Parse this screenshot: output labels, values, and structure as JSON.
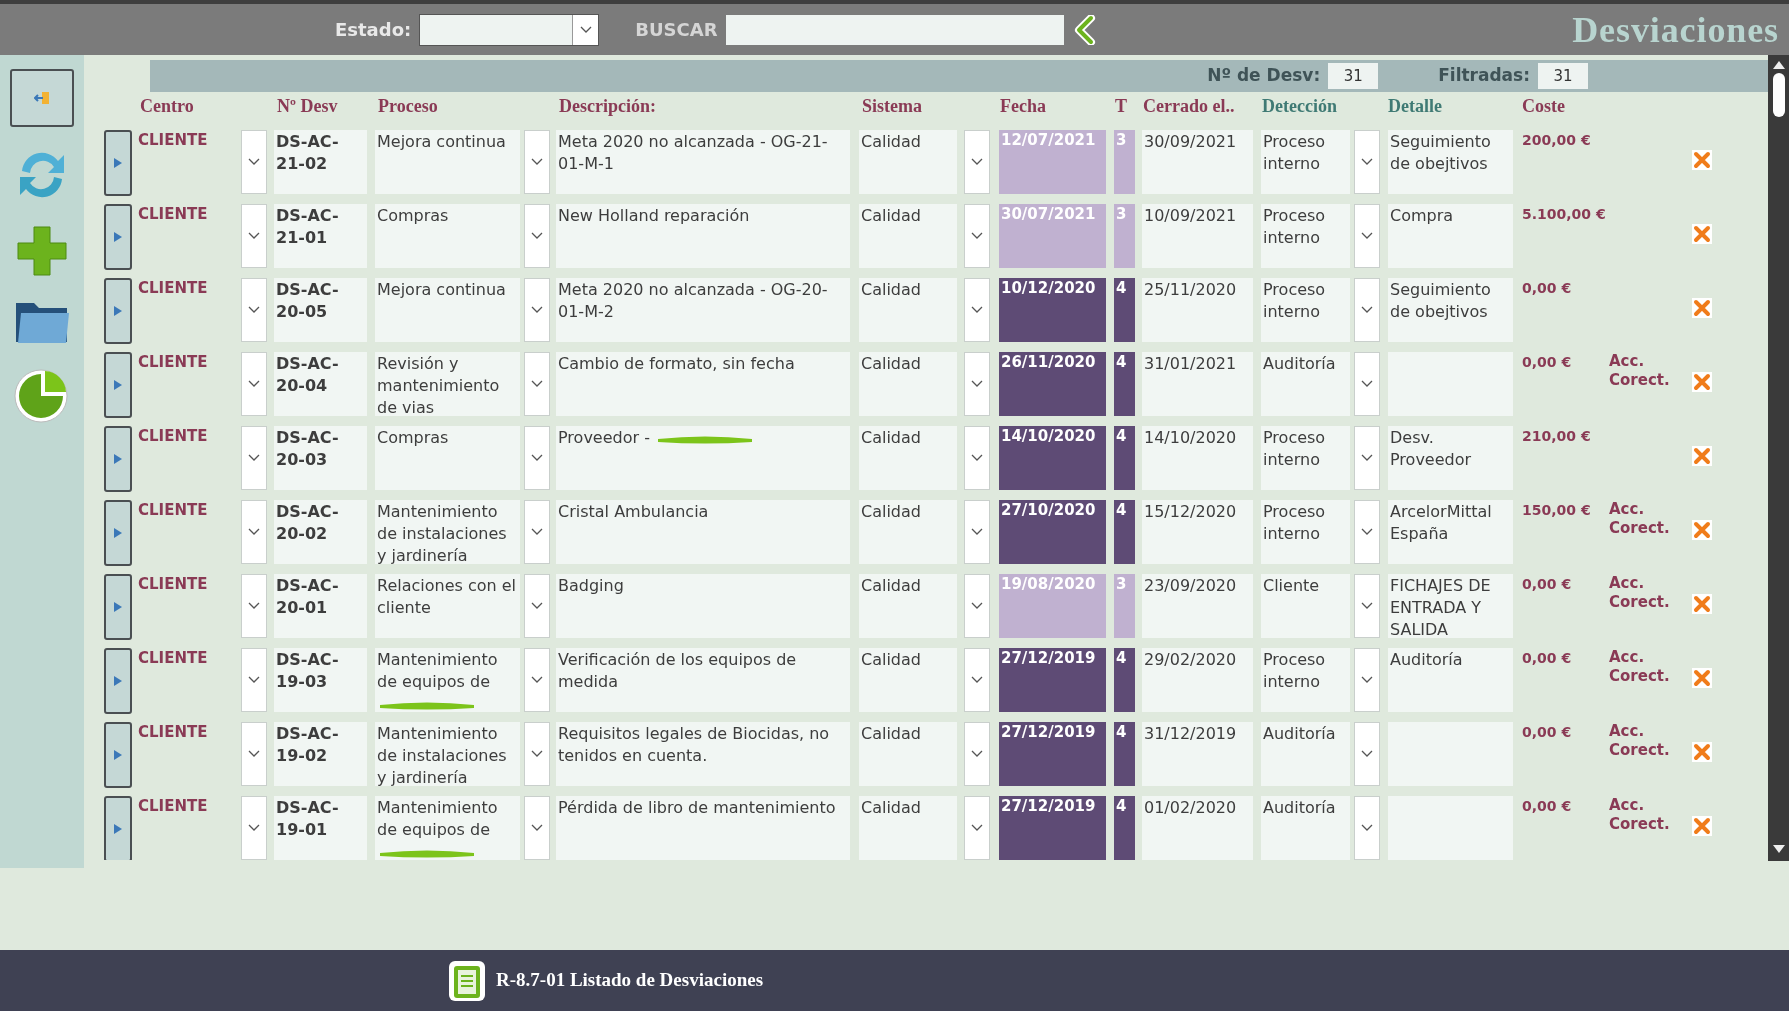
{
  "topbar": {
    "estado_label": "Estado:",
    "buscar_label": "BUSCAR",
    "title": "Desviaciones"
  },
  "counts": {
    "total_label": "Nº de Desv:",
    "total": "31",
    "filtered_label": "Filtradas:",
    "filtered": "31"
  },
  "columns": [
    "Centro",
    "Nº Desv",
    "Proceso",
    "Descripción:",
    "Sistema",
    "Fecha",
    "T",
    "Cerrado el..",
    "Detección",
    "Detalle",
    "Coste"
  ],
  "rows": [
    {
      "centro": "CLIENTE",
      "num": "DS-AC-21-02",
      "proceso": "Mejora continua",
      "descripcion": "Meta 2020 no alcanzada - OG-21-01-M-1",
      "sistema": "Calidad",
      "fecha": "12/07/2021",
      "color": "#c0b1d0",
      "t": "3",
      "cerrado": "30/09/2021",
      "deteccion": "Proceso interno",
      "detalle": "Seguimiento de obejtivos",
      "coste": "200,00 €",
      "checked": true
    },
    {
      "centro": "CLIENTE",
      "num": "DS-AC-21-01",
      "proceso": "Compras",
      "descripcion": "New Holland reparación",
      "sistema": "Calidad",
      "fecha": "30/07/2021",
      "color": "#c0b1d0",
      "t": "3",
      "cerrado": "10/09/2021",
      "deteccion": "Proceso interno",
      "detalle": "Compra",
      "coste": "5.100,00 €",
      "checked": true
    },
    {
      "centro": "CLIENTE",
      "num": "DS-AC-20-05",
      "proceso": "Mejora continua",
      "descripcion": "Meta 2020 no alcanzada - OG-20-01-M-2",
      "sistema": "Calidad",
      "fecha": "10/12/2020",
      "color": "#5e4b75",
      "t": "4",
      "cerrado": "25/11/2020",
      "deteccion": "Proceso interno",
      "detalle": "Seguimiento de obejtivos",
      "coste": "0,00 €",
      "checked": true
    },
    {
      "centro": "CLIENTE",
      "num": "DS-AC-20-04",
      "proceso": "Revisión y mantenimiento de vias",
      "descripcion": "Cambio de formato, sin fecha",
      "sistema": "Calidad",
      "fecha": "26/11/2020",
      "color": "#5e4b75",
      "t": "4",
      "cerrado": "31/01/2021",
      "deteccion": "Auditoría",
      "coste": "0,00 €",
      "accion": "Acc. Corect.",
      "checked": true
    },
    {
      "centro": "CLIENTE",
      "num": "DS-AC-20-03",
      "proceso": "Compras",
      "descripcion": "Proveedor - ",
      "descripcion_redacted": true,
      "sistema": "Calidad",
      "fecha": "14/10/2020",
      "color": "#5e4b75",
      "t": "4",
      "cerrado": "14/10/2020",
      "deteccion": "Proceso interno",
      "detalle": "Desv. Proveedor",
      "coste": "210,00 €",
      "checked": true
    },
    {
      "centro": "CLIENTE",
      "num": "DS-AC-20-02",
      "proceso": "Mantenimiento de instalaciones y jardinería",
      "descripcion": "Cristal Ambulancia",
      "sistema": "Calidad",
      "fecha": "27/10/2020",
      "color": "#5e4b75",
      "t": "4",
      "cerrado": "15/12/2020",
      "deteccion": "Proceso interno",
      "detalle": "ArcelorMittal España",
      "coste": "150,00 €",
      "accion": "Acc. Corect.",
      "checked": true
    },
    {
      "centro": "CLIENTE",
      "num": "DS-AC-20-01",
      "proceso": "Relaciones con el cliente",
      "descripcion": "Badging",
      "sistema": "Calidad",
      "fecha": "19/08/2020",
      "color": "#c0b1d0",
      "t": "3",
      "cerrado": "23/09/2020",
      "deteccion": "Cliente",
      "detalle": "FICHAJES DE ENTRADA Y SALIDA",
      "coste": "0,00 €",
      "accion": "Acc. Corect.",
      "checked": true
    },
    {
      "centro": "CLIENTE",
      "num": "DS-AC-19-03",
      "proceso": "Mantenimiento de equipos de",
      "proceso_redacted": true,
      "descripcion": "Verificación de los equipos de medida",
      "sistema": "Calidad",
      "fecha": "27/12/2019",
      "color": "#5e4b75",
      "t": "4",
      "cerrado": "29/02/2020",
      "deteccion": "Proceso interno",
      "detalle": "Auditoría",
      "coste": "0,00 €",
      "accion": "Acc. Corect.",
      "checked": true
    },
    {
      "centro": "CLIENTE",
      "num": "DS-AC-19-02",
      "proceso": "Mantenimiento de instalaciones y jardinería",
      "descripcion": "Requisitos legales de Biocidas, no tenidos en cuenta.",
      "sistema": "Calidad",
      "fecha": "27/12/2019",
      "color": "#5e4b75",
      "t": "4",
      "cerrado": "31/12/2019",
      "deteccion": "Auditoría",
      "coste": "0,00 €",
      "accion": "Acc. Corect.",
      "checked": true
    },
    {
      "centro": "CLIENTE",
      "num": "DS-AC-19-01",
      "proceso": "Mantenimiento de equipos de",
      "proceso_redacted": true,
      "descripcion": "Pérdida de libro de mantenimiento",
      "sistema": "Calidad",
      "fecha": "27/12/2019",
      "color": "#5e4b75",
      "t": "4",
      "cerrado": "01/02/2020",
      "deteccion": "Auditoría",
      "coste": "0,00 €",
      "accion": "Acc. Corect.",
      "checked": true
    }
  ],
  "footer": {
    "title": "R-8.7-01 Listado de Desviaciones"
  }
}
